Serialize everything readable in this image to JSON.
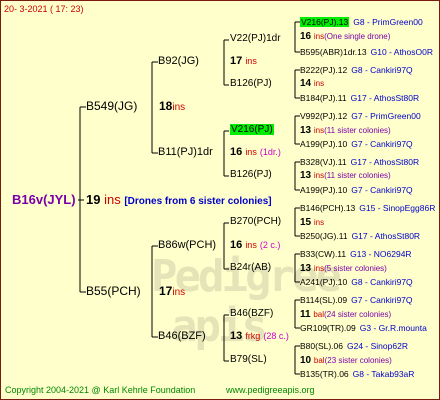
{
  "header": {
    "date": "20- 3-2021 ( 17: 23)"
  },
  "footer": {
    "copyright": "Copyright 2004-2021 @ Karl Kehrle Foundation",
    "website": "www.pedigreeapis.org"
  },
  "root": {
    "name": "B16v(JYL)",
    "num": "19",
    "ins": "ins",
    "note": "[Drones from 6 sister colonies]"
  },
  "g1": [
    {
      "name": "B549(JG)",
      "num": "18",
      "ins": "ins"
    },
    {
      "name": "B55(PCH)",
      "num": "17",
      "ins": "ins"
    }
  ],
  "g2": [
    {
      "name": "B92(JG)",
      "num": "17",
      "ins": "ins"
    },
    {
      "name": "B11(PJ)1dr",
      "num": "16",
      "ins": "ins",
      "note": "(1dr.)"
    },
    {
      "name": "B86w(PCH)",
      "num": "16",
      "ins": "ins",
      "note": "(2 c.)"
    },
    {
      "name": "B46(BZF)",
      "num": "13",
      "ins": "frkg",
      "note": "(28 c.)"
    }
  ],
  "g3": [
    {
      "name": "V22(PJ)1dr",
      "num": "16",
      "ins": "ins",
      "note": "(One single drone)"
    },
    {
      "name": "B126(PJ)",
      "num": "14",
      "ins": "ins",
      "note": ""
    },
    {
      "name": "V216(PJ)",
      "num": "13",
      "ins": "ins",
      "note": "(11 sister colonies)"
    },
    {
      "name": "B126(PJ)",
      "num": "13",
      "ins": "ins",
      "note": "(11 sister colonies)"
    },
    {
      "name": "B270(PCH)",
      "num": "15",
      "ins": "ins",
      "note": ""
    },
    {
      "name": "B24r(AB)",
      "num": "13",
      "ins": "ins",
      "note": "(5 sister colonies)"
    },
    {
      "name": "B46(BZF)",
      "num": "11",
      "ins": "bal",
      "note": "(24 sister colonies)"
    },
    {
      "name": "B79(SL)",
      "num": "10",
      "ins": "bal",
      "note": "(23 sister colonies)"
    }
  ],
  "g4": [
    {
      "name": "V216(PJ).13",
      "code": "G8 - PrimGreen00"
    },
    {
      "name": "B595(ABR)1dr.13",
      "code": "G10 - AthosO0R"
    },
    {
      "name": "B222(PJ).12",
      "code": "G8 - Cankiri97Q"
    },
    {
      "name": "B184(PJ).11",
      "code": "G17 - AthosSt80R"
    },
    {
      "name": "V992(PJ).12",
      "code": "G7 - PrimGreen00"
    },
    {
      "name": "A199(PJ).10",
      "code": "G7 - Cankiri97Q"
    },
    {
      "name": "B328(VJ).11",
      "code": "G17 - AthosSt80R"
    },
    {
      "name": "A199(PJ).10",
      "code": "G7 - Cankiri97Q"
    },
    {
      "name": "B146(PCH).13",
      "code": "G15 - SinopEgg86R"
    },
    {
      "name": "B250(JG).11",
      "code": "G17 - AthosSt80R"
    },
    {
      "name": "B33(CW).11",
      "code": "G13 - NO6294R"
    },
    {
      "name": "A241(PJ).10",
      "code": "G8 - Cankiri97Q"
    },
    {
      "name": "B114(SL).09",
      "code": "G7 - Cankiri97Q"
    },
    {
      "name": "GR109(TR).09",
      "code": "G3 - Gr.R.mounta"
    },
    {
      "name": "B80(SL).06",
      "code": "G24 - Sinop62R"
    },
    {
      "name": "B135(TR).06",
      "code": "G8 - Takab93aR"
    }
  ]
}
